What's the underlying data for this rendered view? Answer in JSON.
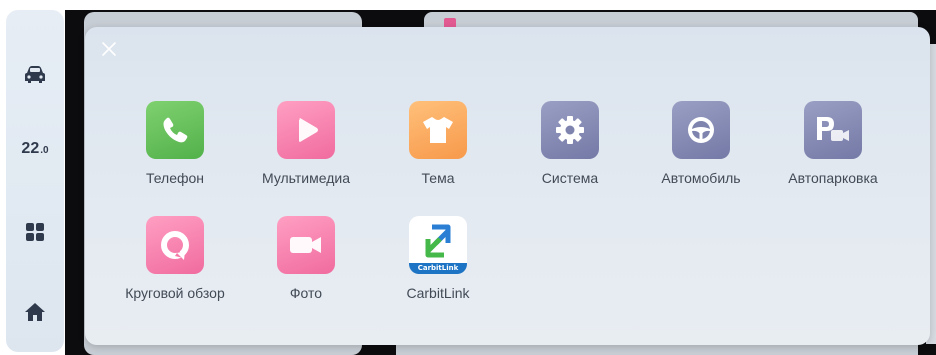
{
  "dock": {
    "temperature_int": "22",
    "temperature_dec": ".0",
    "items": [
      {
        "name": "car-icon"
      },
      {
        "name": "apps-grid-icon"
      },
      {
        "name": "home-icon"
      }
    ]
  },
  "drawer": {
    "close_icon": "close-icon",
    "apps": [
      {
        "label": "Телефон",
        "icon": "phone-icon",
        "color": "#5cbd52"
      },
      {
        "label": "Мультимедиа",
        "icon": "play-icon",
        "color": "#f47aa8"
      },
      {
        "label": "Тема",
        "icon": "tshirt-icon",
        "color": "#f9a55a"
      },
      {
        "label": "Система",
        "icon": "gear-icon",
        "color": "#7f84ae"
      },
      {
        "label": "Автомобиль",
        "icon": "steering-wheel-icon",
        "color": "#7f84ae"
      },
      {
        "label": "Автопарковка",
        "icon": "parking-camera-icon",
        "color": "#7f84ae"
      },
      {
        "label": "Круговой обзор",
        "icon": "surround-view-icon",
        "color": "#f47aa8"
      },
      {
        "label": "Фото",
        "icon": "video-camera-icon",
        "color": "#f47aa8"
      },
      {
        "label": "CarbitLink",
        "icon": "carbitlink-icon",
        "badge": "CarbitLink",
        "color": "#1d74c5"
      }
    ]
  },
  "colors": {
    "dock_bg": "#e2e9f1",
    "drawer_bg": "#e0e7ef",
    "label_text": "#424a56"
  }
}
